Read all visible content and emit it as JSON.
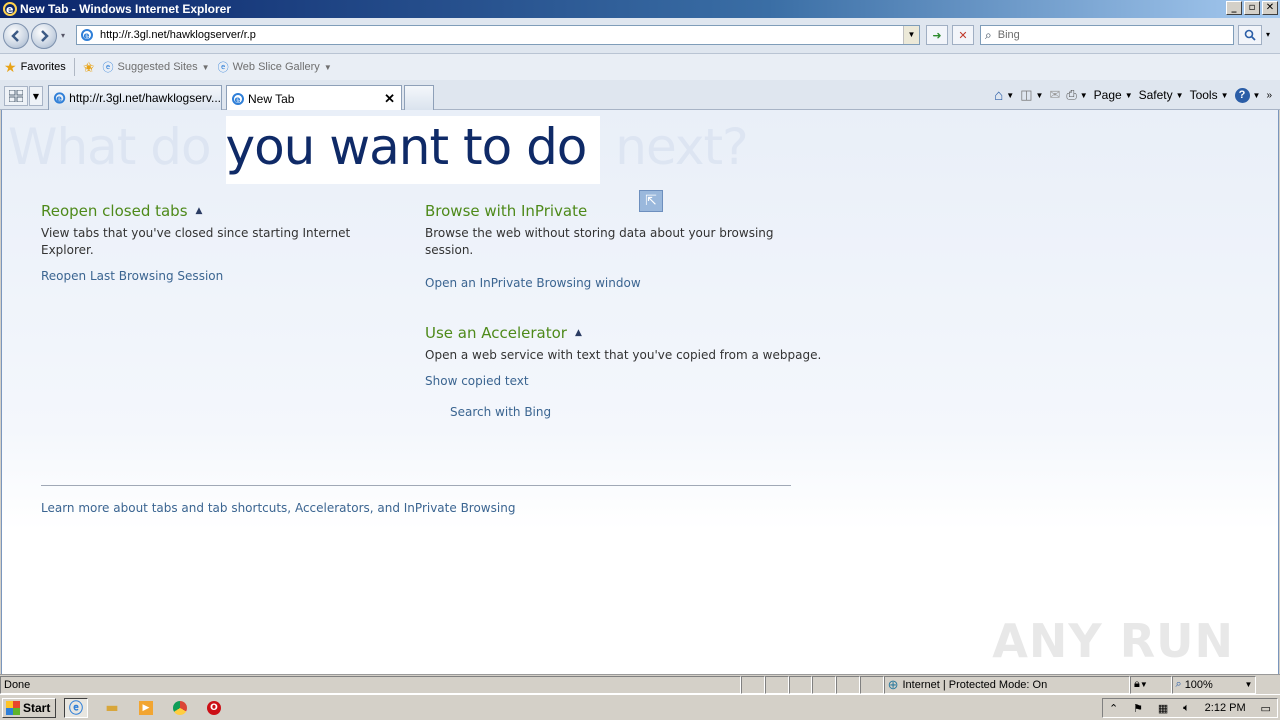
{
  "window": {
    "title": "New Tab - Windows Internet Explorer"
  },
  "address": {
    "url": "http://r.3gl.net/hawklogserver/r.p"
  },
  "search": {
    "placeholder": "Bing"
  },
  "favorites_bar": {
    "favorites_label": "Favorites",
    "suggested_sites": "Suggested Sites",
    "web_slice_gallery": "Web Slice Gallery"
  },
  "tabs": [
    {
      "title": "http://r.3gl.net/hawklogserv...",
      "active": false
    },
    {
      "title": "New Tab",
      "active": true
    }
  ],
  "command_bar": {
    "page": "Page",
    "safety": "Safety",
    "tools": "Tools"
  },
  "content": {
    "headline_before": "What do ",
    "headline_highlight": "you want to do",
    "headline_after": " next?",
    "reopen": {
      "title": "Reopen closed tabs",
      "desc": "View tabs that you've closed since starting Internet Explorer.",
      "link": "Reopen Last Browsing Session"
    },
    "inprivate": {
      "title": "Browse with InPrivate",
      "desc": "Browse the web without storing data about your browsing session.",
      "link": "Open an InPrivate Browsing window"
    },
    "accelerator": {
      "title": "Use an Accelerator",
      "desc": "Open a web service with text that you've copied from a webpage.",
      "link": "Show copied text",
      "sub_link": "Search with Bing"
    },
    "learn_more": "Learn more about tabs and tab shortcuts, Accelerators, and InPrivate Browsing",
    "watermark": "ANY RUN"
  },
  "status": {
    "text": "Done",
    "zone": "Internet | Protected Mode: On",
    "zoom": "100%"
  },
  "taskbar": {
    "start": "Start",
    "clock": "2:12 PM"
  }
}
